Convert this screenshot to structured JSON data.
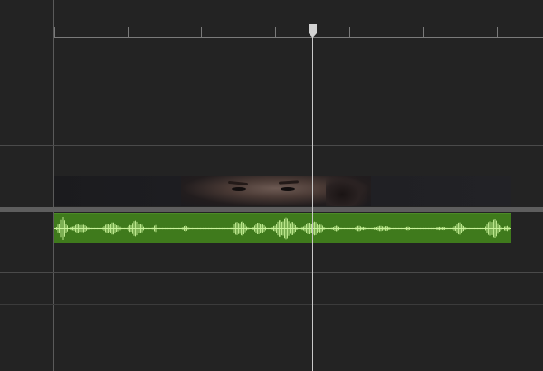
{
  "timeline": {
    "ruler": {
      "tick_count": 7
    },
    "playhead": {
      "icon": "playhead-marker-icon"
    },
    "video_clip": {
      "kind": "video",
      "thumbnail": "person-face-thumbnail"
    },
    "audio_clip": {
      "kind": "audio",
      "color": "#3f7a1c",
      "waveform_color": "#c9f29a"
    }
  }
}
